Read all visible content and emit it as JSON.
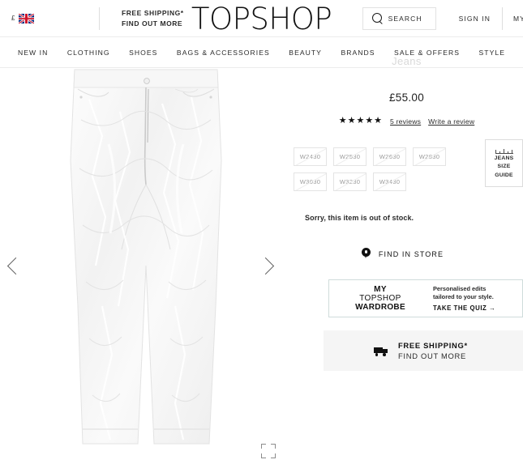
{
  "header": {
    "currency_symbol": "£",
    "flag_icon": "uk-flag-icon",
    "shipping_line1": "FREE SHIPPING*",
    "shipping_line2": "FIND OUT MORE",
    "brand": "TOPSHOP",
    "search_label": "SEARCH",
    "search_icon": "search-icon",
    "sign_in": "SIGN IN",
    "my_bag": "MY BAG"
  },
  "nav": {
    "items": [
      {
        "label": "NEW IN"
      },
      {
        "label": "CLOTHING"
      },
      {
        "label": "SHOES"
      },
      {
        "label": "BAGS & ACCESSORIES"
      },
      {
        "label": "BEAUTY"
      },
      {
        "label": "BRANDS"
      },
      {
        "label": "SALE & OFFERS"
      },
      {
        "label": "STYLE"
      }
    ]
  },
  "gallery": {
    "prev_icon": "chevron-left-icon",
    "next_icon": "chevron-right-icon",
    "expand_icon": "expand-fullscreen-icon",
    "product_image_alt": "Clear Plastic Jeans"
  },
  "product": {
    "title": "Jeans",
    "price": "£55.00",
    "stars": "★★★★★",
    "rating": 5,
    "reviews_link": "5 reviews",
    "write_review_link": "Write a review",
    "sizes": [
      {
        "label": "W2430",
        "available": false
      },
      {
        "label": "W2530",
        "available": false
      },
      {
        "label": "W2630",
        "available": false
      },
      {
        "label": "W2830",
        "available": false
      },
      {
        "label": "W3030",
        "available": false
      },
      {
        "label": "W3230",
        "available": false
      },
      {
        "label": "W3430",
        "available": false
      }
    ],
    "size_guide": {
      "icon": "ruler-icon",
      "line1": "JEANS",
      "line2": "SIZE",
      "line3": "GUIDE"
    },
    "stock_message": "Sorry, this item is out of stock.",
    "find_in_store": {
      "icon": "map-pin-icon",
      "label": "FIND IN STORE"
    }
  },
  "wardrobe_promo": {
    "line1": "MY",
    "line2": "TOPSHOP",
    "line3": "WARDROBE",
    "sub1": "Personalised edits",
    "sub2": "tailored to your style.",
    "cta": "TAKE THE QUIZ →",
    "border_color": "#cfdcdb"
  },
  "shipping_banner": {
    "icon": "truck-icon",
    "line1": "FREE SHIPPING*",
    "line2": "FIND OUT MORE",
    "background": "#f5f5f5"
  }
}
